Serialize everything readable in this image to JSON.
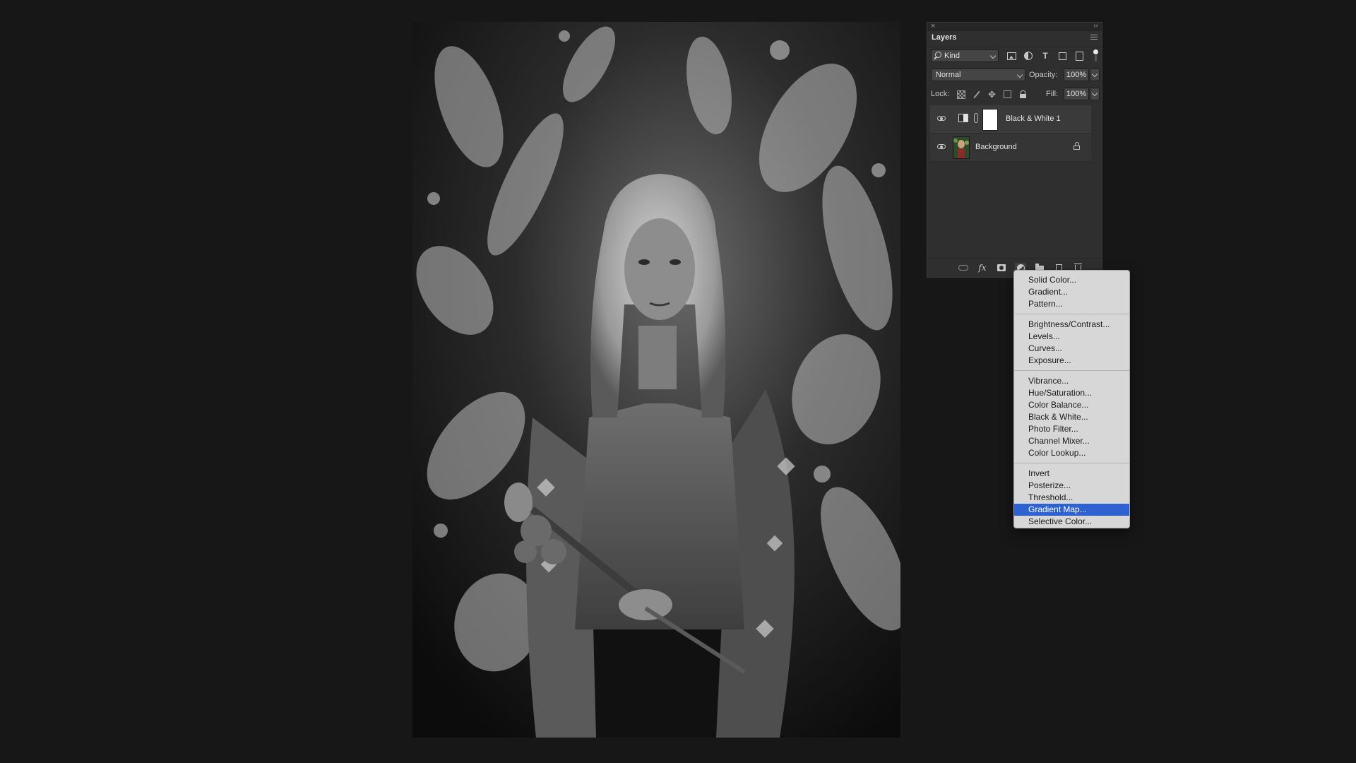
{
  "layers_panel": {
    "title": "Layers",
    "close_glyph": "×",
    "collapse_glyph": "‹‹",
    "filter": {
      "kind_label": "Kind",
      "icons": [
        "pixel-layer-filter-icon",
        "adjustment-layer-filter-icon",
        "type-layer-filter-icon",
        "shape-layer-filter-icon",
        "smart-object-filter-icon"
      ],
      "type_glyph": "T"
    },
    "blend_mode": "Normal",
    "opacity_label": "Opacity:",
    "opacity_value": "100%",
    "lock_label": "Lock:",
    "fill_label": "Fill:",
    "fill_value": "100%",
    "layers": [
      {
        "name": "Black & White 1",
        "type": "adjustment",
        "visible": true
      },
      {
        "name": "Background",
        "type": "pixel",
        "visible": true,
        "locked": true
      }
    ],
    "footer_icons": [
      "link-layers-icon",
      "fx-icon",
      "add-mask-icon",
      "adjustment-layer-icon",
      "group-folder-icon",
      "new-layer-icon",
      "trash-icon"
    ],
    "fx_label": "fx"
  },
  "adjustment_menu": {
    "groups": [
      [
        "Solid Color...",
        "Gradient...",
        "Pattern..."
      ],
      [
        "Brightness/Contrast...",
        "Levels...",
        "Curves...",
        "Exposure..."
      ],
      [
        "Vibrance...",
        "Hue/Saturation...",
        "Color Balance...",
        "Black & White...",
        "Photo Filter...",
        "Channel Mixer...",
        "Color Lookup..."
      ],
      [
        "Invert",
        "Posterize...",
        "Threshold...",
        "Gradient Map...",
        "Selective Color..."
      ]
    ],
    "selected": "Gradient Map...",
    "selected_color": "#2e62d2"
  },
  "canvas": {
    "content": "black-and-white-portrait-photo"
  }
}
